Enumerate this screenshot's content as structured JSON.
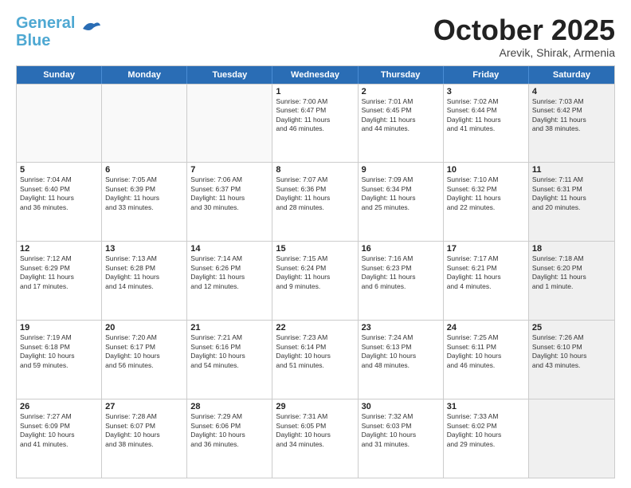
{
  "header": {
    "logo_line1": "General",
    "logo_line2": "Blue",
    "month": "October 2025",
    "location": "Arevik, Shirak, Armenia"
  },
  "weekdays": [
    "Sunday",
    "Monday",
    "Tuesday",
    "Wednesday",
    "Thursday",
    "Friday",
    "Saturday"
  ],
  "rows": [
    [
      {
        "day": "",
        "info": "",
        "empty": true
      },
      {
        "day": "",
        "info": "",
        "empty": true
      },
      {
        "day": "",
        "info": "",
        "empty": true
      },
      {
        "day": "1",
        "info": "Sunrise: 7:00 AM\nSunset: 6:47 PM\nDaylight: 11 hours\nand 46 minutes."
      },
      {
        "day": "2",
        "info": "Sunrise: 7:01 AM\nSunset: 6:45 PM\nDaylight: 11 hours\nand 44 minutes."
      },
      {
        "day": "3",
        "info": "Sunrise: 7:02 AM\nSunset: 6:44 PM\nDaylight: 11 hours\nand 41 minutes."
      },
      {
        "day": "4",
        "info": "Sunrise: 7:03 AM\nSunset: 6:42 PM\nDaylight: 11 hours\nand 38 minutes.",
        "shaded": true
      }
    ],
    [
      {
        "day": "5",
        "info": "Sunrise: 7:04 AM\nSunset: 6:40 PM\nDaylight: 11 hours\nand 36 minutes."
      },
      {
        "day": "6",
        "info": "Sunrise: 7:05 AM\nSunset: 6:39 PM\nDaylight: 11 hours\nand 33 minutes."
      },
      {
        "day": "7",
        "info": "Sunrise: 7:06 AM\nSunset: 6:37 PM\nDaylight: 11 hours\nand 30 minutes."
      },
      {
        "day": "8",
        "info": "Sunrise: 7:07 AM\nSunset: 6:36 PM\nDaylight: 11 hours\nand 28 minutes."
      },
      {
        "day": "9",
        "info": "Sunrise: 7:09 AM\nSunset: 6:34 PM\nDaylight: 11 hours\nand 25 minutes."
      },
      {
        "day": "10",
        "info": "Sunrise: 7:10 AM\nSunset: 6:32 PM\nDaylight: 11 hours\nand 22 minutes."
      },
      {
        "day": "11",
        "info": "Sunrise: 7:11 AM\nSunset: 6:31 PM\nDaylight: 11 hours\nand 20 minutes.",
        "shaded": true
      }
    ],
    [
      {
        "day": "12",
        "info": "Sunrise: 7:12 AM\nSunset: 6:29 PM\nDaylight: 11 hours\nand 17 minutes."
      },
      {
        "day": "13",
        "info": "Sunrise: 7:13 AM\nSunset: 6:28 PM\nDaylight: 11 hours\nand 14 minutes."
      },
      {
        "day": "14",
        "info": "Sunrise: 7:14 AM\nSunset: 6:26 PM\nDaylight: 11 hours\nand 12 minutes."
      },
      {
        "day": "15",
        "info": "Sunrise: 7:15 AM\nSunset: 6:24 PM\nDaylight: 11 hours\nand 9 minutes."
      },
      {
        "day": "16",
        "info": "Sunrise: 7:16 AM\nSunset: 6:23 PM\nDaylight: 11 hours\nand 6 minutes."
      },
      {
        "day": "17",
        "info": "Sunrise: 7:17 AM\nSunset: 6:21 PM\nDaylight: 11 hours\nand 4 minutes."
      },
      {
        "day": "18",
        "info": "Sunrise: 7:18 AM\nSunset: 6:20 PM\nDaylight: 11 hours\nand 1 minute.",
        "shaded": true
      }
    ],
    [
      {
        "day": "19",
        "info": "Sunrise: 7:19 AM\nSunset: 6:18 PM\nDaylight: 10 hours\nand 59 minutes."
      },
      {
        "day": "20",
        "info": "Sunrise: 7:20 AM\nSunset: 6:17 PM\nDaylight: 10 hours\nand 56 minutes."
      },
      {
        "day": "21",
        "info": "Sunrise: 7:21 AM\nSunset: 6:16 PM\nDaylight: 10 hours\nand 54 minutes."
      },
      {
        "day": "22",
        "info": "Sunrise: 7:23 AM\nSunset: 6:14 PM\nDaylight: 10 hours\nand 51 minutes."
      },
      {
        "day": "23",
        "info": "Sunrise: 7:24 AM\nSunset: 6:13 PM\nDaylight: 10 hours\nand 48 minutes."
      },
      {
        "day": "24",
        "info": "Sunrise: 7:25 AM\nSunset: 6:11 PM\nDaylight: 10 hours\nand 46 minutes."
      },
      {
        "day": "25",
        "info": "Sunrise: 7:26 AM\nSunset: 6:10 PM\nDaylight: 10 hours\nand 43 minutes.",
        "shaded": true
      }
    ],
    [
      {
        "day": "26",
        "info": "Sunrise: 7:27 AM\nSunset: 6:09 PM\nDaylight: 10 hours\nand 41 minutes."
      },
      {
        "day": "27",
        "info": "Sunrise: 7:28 AM\nSunset: 6:07 PM\nDaylight: 10 hours\nand 38 minutes."
      },
      {
        "day": "28",
        "info": "Sunrise: 7:29 AM\nSunset: 6:06 PM\nDaylight: 10 hours\nand 36 minutes."
      },
      {
        "day": "29",
        "info": "Sunrise: 7:31 AM\nSunset: 6:05 PM\nDaylight: 10 hours\nand 34 minutes."
      },
      {
        "day": "30",
        "info": "Sunrise: 7:32 AM\nSunset: 6:03 PM\nDaylight: 10 hours\nand 31 minutes."
      },
      {
        "day": "31",
        "info": "Sunrise: 7:33 AM\nSunset: 6:02 PM\nDaylight: 10 hours\nand 29 minutes."
      },
      {
        "day": "",
        "info": "",
        "empty": true,
        "shaded": true
      }
    ]
  ]
}
